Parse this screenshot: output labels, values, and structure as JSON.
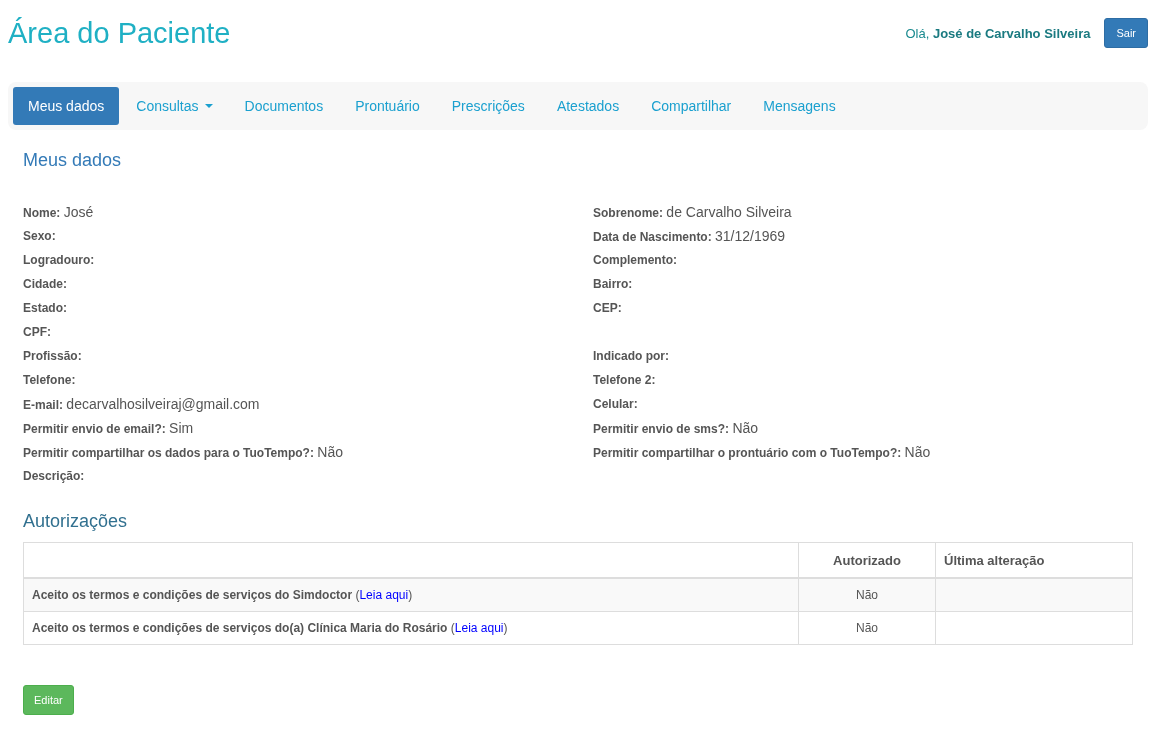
{
  "header": {
    "title": "Área do Paciente",
    "greeting": "Olá, **José de Carvalho Silveira**",
    "logout_button": "Sair"
  },
  "nav": [
    {
      "label": "Meus dados",
      "selected": true,
      "kind": "link"
    },
    {
      "label": "Consultas",
      "selected": false,
      "kind": "dropdown"
    },
    {
      "label": "Documentos",
      "selected": false,
      "kind": "link"
    },
    {
      "label": "Prontuário",
      "selected": false,
      "kind": "link"
    },
    {
      "label": "Prescrições",
      "selected": false,
      "kind": "link"
    },
    {
      "label": "Atestados",
      "selected": false,
      "kind": "link"
    },
    {
      "label": "Compartilhar",
      "selected": false,
      "kind": "link"
    },
    {
      "label": "Mensagens",
      "selected": false,
      "kind": "link"
    }
  ],
  "section_title": "Meus dados",
  "fields": [
    {
      "left": {
        "label": "Nome:",
        "value": "José"
      },
      "right": {
        "label": "Sobrenome:",
        "value": "de Carvalho Silveira"
      }
    },
    {
      "left": {
        "label": "Sexo:"
      },
      "right": {
        "label": "Data de Nascimento:",
        "value": "31/12/1969"
      }
    },
    {
      "left": {
        "label": "Logradouro:"
      },
      "right": {
        "label": "Complemento:"
      }
    },
    {
      "left": {
        "label": "Cidade:"
      },
      "right": {
        "label": "Bairro:"
      }
    },
    {
      "left": {
        "label": "Estado:"
      },
      "right": {
        "label": "CEP:"
      }
    },
    {
      "left": {
        "label": "CPF:"
      }
    },
    {
      "left": {
        "label": "Profissão:"
      },
      "right": {
        "label": "Indicado por:"
      }
    },
    {
      "left": {
        "label": "Telefone:"
      },
      "right": {
        "label": "Telefone 2:"
      }
    },
    {
      "left": {
        "label": "E-mail:",
        "value": "decarvalhosilveiraj@gmail.com"
      },
      "right": {
        "label": "Celular:"
      }
    },
    {
      "left": {
        "label": "Permitir envio de email?:",
        "value": "Sim"
      },
      "right": {
        "label": "Permitir envio de sms?:",
        "value": "Não"
      }
    },
    {
      "left": {
        "label": "Permitir compartilhar os dados para o TuoTempo?:",
        "value": "Não"
      },
      "right": {
        "label": "Permitir compartilhar o prontuário com o TuoTempo?:",
        "value": "Não"
      }
    },
    {
      "left": {
        "label": "Descrição:"
      }
    }
  ],
  "authorizations": {
    "title": "Autorizações",
    "columns": [
      "Autorizado",
      "Última alteração"
    ],
    "rows": [
      {
        "term": "**Aceito os termos e condições de serviços do Simdoctor** (",
        "link": "Leia aqui",
        "after": ")",
        "authorized": "Não"
      },
      {
        "term": "**Aceito os termos e condições de serviços do(a) Clínica Maria do Rosário** (",
        "link": "Leia aqui",
        "after": ")",
        "authorized": "Não"
      }
    ]
  },
  "edit_button": "Editar"
}
